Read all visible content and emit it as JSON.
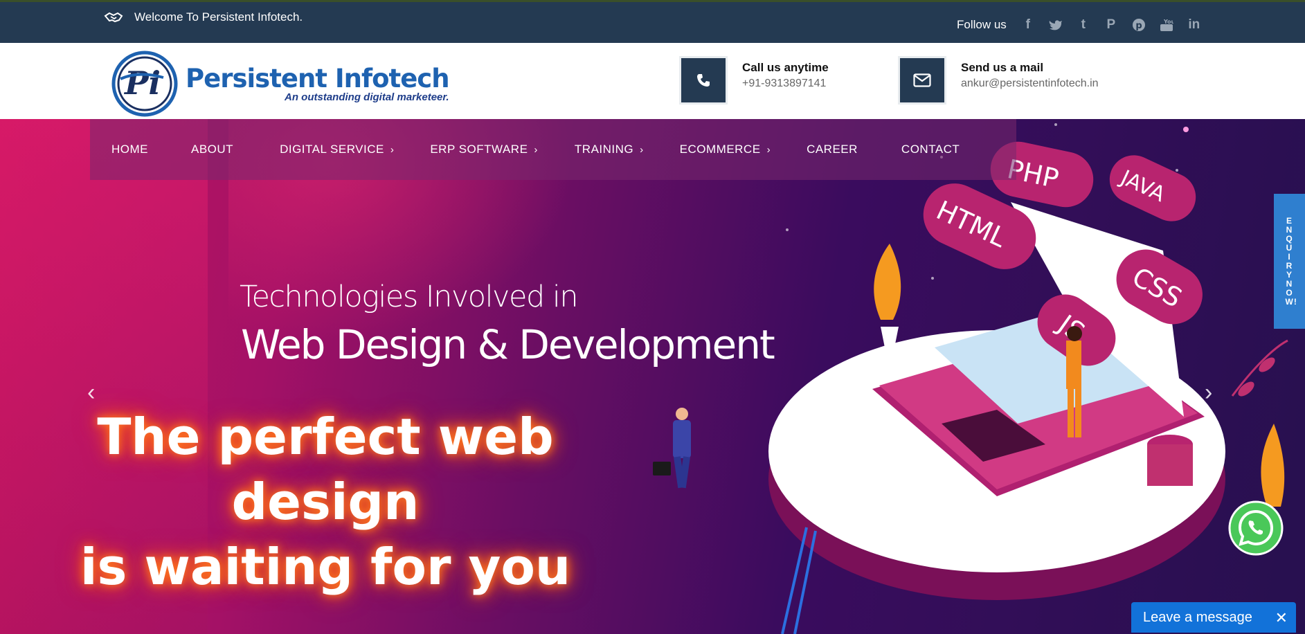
{
  "topbar": {
    "welcome": "Welcome To Persistent Infotech.",
    "follow_label": "Follow us",
    "social_icons": [
      "facebook-icon",
      "twitter-icon",
      "tumblr-icon",
      "pinterest-icon",
      "pinterest-circle-icon",
      "youtube-icon",
      "linkedin-icon"
    ]
  },
  "header": {
    "logo_name": "Persistent Infotech",
    "logo_tagline": "An outstanding digital marketeer.",
    "call_title": "Call us anytime",
    "call_value": "+91-9313897141",
    "mail_title": "Send us a mail",
    "mail_value": "ankur@persistentinfotech.in"
  },
  "nav": {
    "items": [
      "HOME",
      "ABOUT",
      "DIGITAL SERVICE",
      "ERP SOFTWARE",
      "TRAINING",
      "ECOMMERCE",
      "CAREER",
      "CONTACT"
    ],
    "chevron": "›"
  },
  "hero": {
    "subtitle_line1": "Technologies Involved in",
    "subtitle_line2": "Web Design & Development",
    "headline_line1": "The perfect web design",
    "headline_line2": "is waiting for you",
    "bubbles": [
      "PHP",
      "JAVA",
      "HTML",
      "CSS",
      "JS"
    ],
    "prev_arrow": "‹",
    "next_arrow": "›"
  },
  "enquiry": {
    "label": "ENQUIRY NOW!"
  },
  "chat": {
    "label": "Leave a message",
    "close": "✕"
  },
  "colors": {
    "topbar": "#243a52",
    "brand_blue": "#1e62b0",
    "chat_blue": "#1272d9",
    "enquiry_blue": "#2f7fcf"
  }
}
